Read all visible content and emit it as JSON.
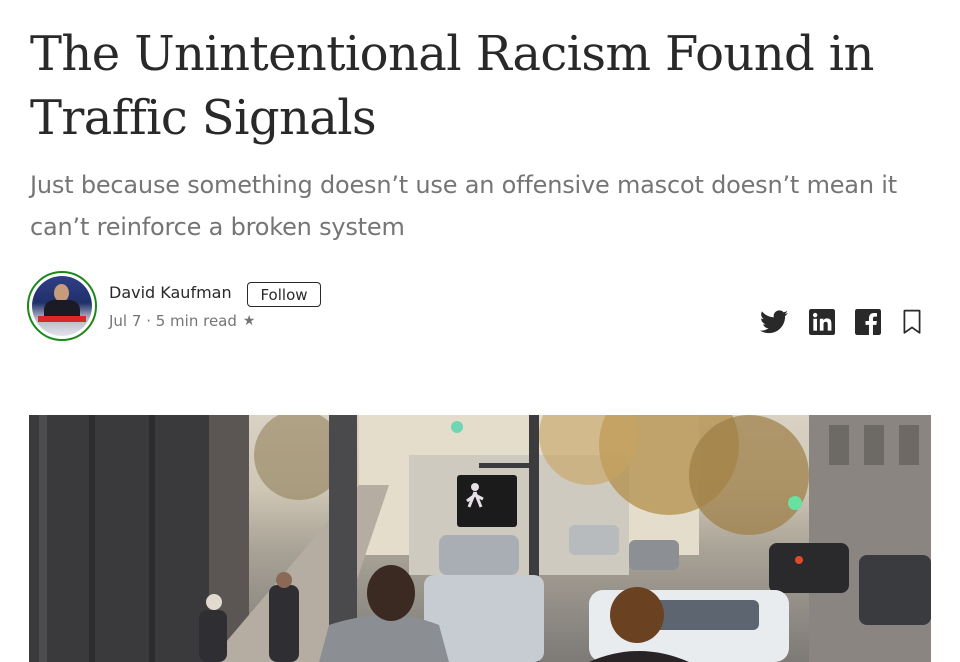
{
  "article": {
    "title": "The Unintentional Racism Found in Traffic Signals",
    "subtitle": "Just because something doesn’t use an offensive mascot doesn’t mean it can’t reinforce a broken system"
  },
  "author": {
    "name": "David Kaufman",
    "follow_label": "Follow",
    "date": "Jul 7",
    "separator": " · ",
    "read_time": "5 min read",
    "member_star": "★"
  },
  "share": {
    "icons": [
      "twitter-icon",
      "linkedin-icon",
      "facebook-icon",
      "bookmark-icon"
    ]
  },
  "colors": {
    "text": "#292929",
    "muted": "#757575",
    "avatar_ring": "#1a8917"
  }
}
